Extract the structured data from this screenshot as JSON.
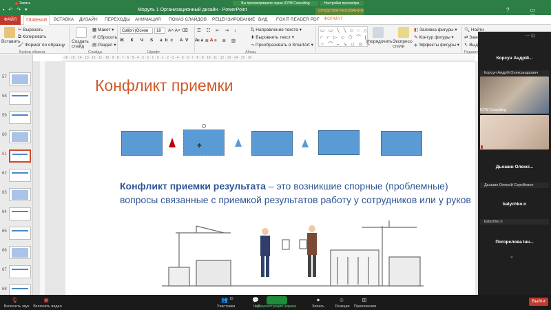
{
  "zoom": {
    "recording_label": "Запись",
    "share_banner": "Вы просматриваете экран ICPM Consulting",
    "share_settings": "Настройки просмотра",
    "participants": [
      {
        "header": "Корсун Андрій...",
        "name_tag": "Корсун Андрій Олександрович",
        "video_caption": "ICPM Consulting"
      },
      {
        "header": "",
        "name_tag": "",
        "video_caption": ""
      },
      {
        "header": "Дьошин Олексі...",
        "name_tag": "Дьошин Олексій Сергійович",
        "video_caption": ""
      },
      {
        "header": "batychko.n",
        "name_tag": "batychko.n",
        "video_caption": ""
      },
      {
        "header": "Погорєлова Інн...",
        "name_tag": "",
        "video_caption": ""
      }
    ],
    "toolbar": {
      "mute": "Включить звук",
      "video": "Включить видео",
      "participants": "Участники",
      "participants_count": "15",
      "chat": "Чат",
      "share": "Демонстрация экрана",
      "record": "Запись",
      "reactions": "Реакции",
      "apps": "Приложения",
      "leave": "Выйти"
    }
  },
  "ppt": {
    "window_title": "Модуль 1 Организационный дизайн - PowerPoint",
    "contextual_group": "СРЕДСТВА РИСОВАНИЯ",
    "tabs": [
      "ФАЙЛ",
      "ГЛАВНАЯ",
      "ВСТАВКА",
      "ДИЗАЙН",
      "ПЕРЕХОДЫ",
      "АНИМАЦИЯ",
      "ПОКАЗ СЛАЙДОВ",
      "РЕЦЕНЗИРОВАНИЕ",
      "ВИД",
      "FOXIT READER PDF",
      "ФОРМАТ"
    ],
    "ribbon": {
      "paste": "Вставить",
      "cut": "Вырезать",
      "copy": "Копировать",
      "format_painter": "Формат по образцу",
      "group_clipboard": "Буфер обмена",
      "new_slide": "Создать слайд",
      "layout": "Макет",
      "reset": "Сбросить",
      "section": "Раздел",
      "group_slides": "Слайды",
      "font_name": "Calibri (Основ",
      "font_size": "18",
      "group_font": "Шрифт",
      "text_direction": "Направление текста",
      "align_text": "Выровнять текст",
      "smartart": "Преобразовать в SmartArt",
      "group_paragraph": "Абзац",
      "arrange": "Упорядочить",
      "quick_styles": "Экспресс-стили",
      "shape_fill": "Заливка фигуры",
      "shape_outline": "Контур фигуры",
      "shape_effects": "Эффекты фигуры",
      "find": "Найти",
      "replace": "Заме",
      "select": "Выде",
      "group_editing": "Редактир"
    },
    "slide_numbers": [
      "57",
      "58",
      "59",
      "60",
      "61",
      "62",
      "63",
      "64",
      "65",
      "66",
      "67",
      "68"
    ],
    "selected_slide": "61",
    "slide": {
      "title": "Конфликт приемки",
      "body_bold": "Конфликт приемки результата",
      "body_rest": " – это возникшие спорные (проблемные) вопросы связанные с приемкой результатов работу у сотрудников или у руков"
    }
  },
  "colors": {
    "ppt_accent": "#d24726",
    "title_color": "#d05a2a",
    "body_color": "#2f5597",
    "shape_fill": "#5b9bd5",
    "triangle_red": "#c00000",
    "zoom_green": "#1e8c3a",
    "leave_red": "#c0392b"
  }
}
